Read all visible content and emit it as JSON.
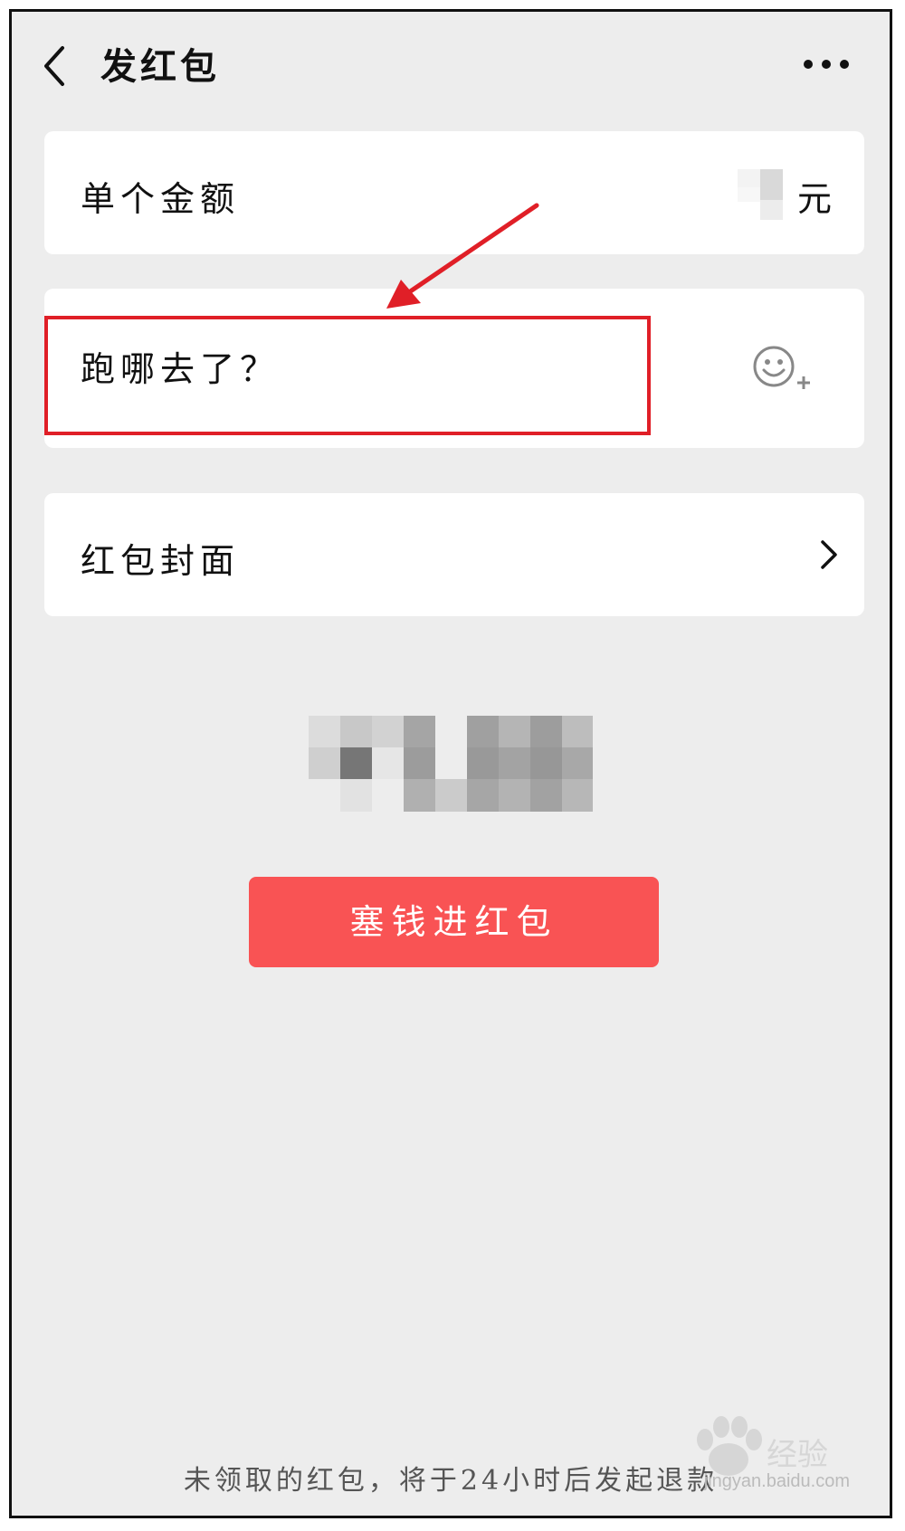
{
  "header": {
    "title": "发红包"
  },
  "amount_card": {
    "label": "单个金额",
    "unit": "元"
  },
  "message_card": {
    "placeholder": "跑哪去了？"
  },
  "cover_card": {
    "label": "红包封面"
  },
  "submit_button": {
    "label": "塞钱进红包"
  },
  "footer": {
    "notice": "未领取的红包，将于24小时后发起退款"
  },
  "watermark": {
    "brand": "Baidu经验",
    "url": "jingyan.baidu.com"
  },
  "colors": {
    "accent": "#f95354",
    "background": "#ededed",
    "annotation": "#e01f27"
  },
  "icons": [
    "back-icon",
    "more-icon",
    "emoji-add-icon",
    "chevron-right-icon"
  ]
}
